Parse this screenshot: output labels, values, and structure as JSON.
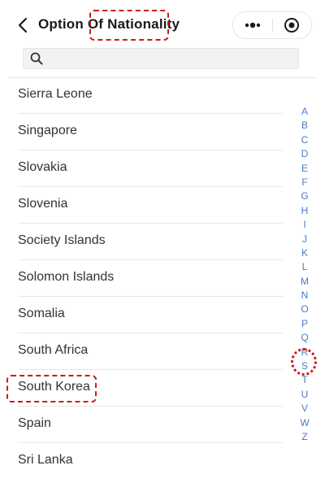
{
  "header": {
    "title": "Option Of Nationality"
  },
  "search": {
    "placeholder": "",
    "value": ""
  },
  "countries": [
    "Sierra Leone",
    "Singapore",
    "Slovakia",
    "Slovenia",
    "Society Islands",
    "Solomon Islands",
    "Somalia",
    "South Africa",
    "South Korea",
    "Spain",
    "Sri Lanka"
  ],
  "alphabet": [
    "A",
    "B",
    "C",
    "D",
    "E",
    "F",
    "G",
    "H",
    "I",
    "J",
    "K",
    "L",
    "M",
    "N",
    "O",
    "P",
    "Q",
    "R",
    "S",
    "T",
    "U",
    "V",
    "W",
    "Z"
  ],
  "selected": {
    "country": "South Korea",
    "letter": "S"
  },
  "colors": {
    "accent": "#4a7bc8",
    "highlight": "#cc1b1b"
  },
  "icons": {
    "back": "chevron-left-icon",
    "more": "more-dots-icon",
    "close": "target-circle-icon",
    "search": "search-icon"
  }
}
